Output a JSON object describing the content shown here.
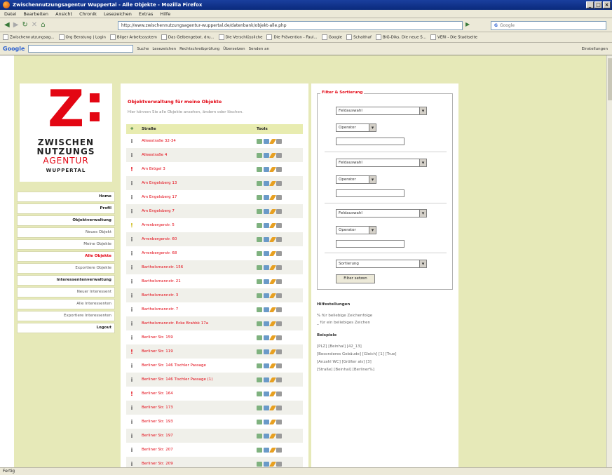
{
  "window": {
    "title": "Zwischennutzungsagentur Wuppertal - Alle Objekte - Mozilla Firefox"
  },
  "menu": [
    "Datei",
    "Bearbeiten",
    "Ansicht",
    "Chronik",
    "Lesezeichen",
    "Extras",
    "Hilfe"
  ],
  "address": {
    "url": "http://www.zwischennutzungsagentur-wuppertal.de/datenbank/objekt-alle.php",
    "search_placeholder": "Google"
  },
  "bookmarks": [
    "Zwischennutzungsag...",
    "Org Beratung | Login",
    "Bilger Arbeitssystem",
    "Das Gelbengebot. dru...",
    "Die Verschlüssliche",
    "Die Prävention - Faul...",
    "Google",
    "Schalthaf",
    "BIG-Diks. Die neue S...",
    "VERI - Die Stadtseite"
  ],
  "googlebar": {
    "logo": "Google",
    "items": [
      "Suche",
      "Lesezeichen",
      "Rechtschreibprüfung",
      "Übersetzen",
      "Senden an"
    ],
    "settings": "Einstellungen"
  },
  "logo": {
    "mark": "Z",
    "line1": "ZWISCHEN",
    "line2": "NUTZUNGS",
    "line3": "AGENTUR",
    "line4": "WUPPERTAL"
  },
  "nav": [
    {
      "label": "Home",
      "style": "bold"
    },
    {
      "label": "Profil",
      "style": "bold"
    },
    {
      "label": "Objektverwaltung",
      "style": "bold"
    },
    {
      "label": "Neues Objekt",
      "style": "normal"
    },
    {
      "label": "Meine Objekte",
      "style": "normal"
    },
    {
      "label": "Alle Objekte",
      "style": "active"
    },
    {
      "label": "Exportiere Objekte",
      "style": "normal"
    },
    {
      "label": "Interessentenverwaltung",
      "style": "bold"
    },
    {
      "label": "Neuer Interessent",
      "style": "normal"
    },
    {
      "label": "Alle Interessenten",
      "style": "normal"
    },
    {
      "label": "Exportiere Interessenten",
      "style": "normal"
    },
    {
      "label": "Logout",
      "style": "bold"
    }
  ],
  "main": {
    "title": "Objektverwaltung für meine Objekte",
    "description": "Hier können Sie alle Objekte ansehen, ändern oder löschen.",
    "col_street": "Straße",
    "col_tools": "Tools",
    "rows": [
      {
        "status": "i",
        "status_color": "grey",
        "street": "Alleestraße 32-34"
      },
      {
        "status": "i",
        "status_color": "grey",
        "street": "Alleestraße 4"
      },
      {
        "status": "!",
        "status_color": "red",
        "street": "Am Brögel 3"
      },
      {
        "status": "i",
        "status_color": "grey",
        "street": "Am Engelsberg 13"
      },
      {
        "status": "i",
        "status_color": "grey",
        "street": "Am Engelsberg 17"
      },
      {
        "status": "i",
        "status_color": "grey",
        "street": "Am Engelsberg 7"
      },
      {
        "status": "!",
        "status_color": "yellow",
        "street": "Arrenbergerstr. 5"
      },
      {
        "status": "i",
        "status_color": "grey",
        "street": "Arrenbergerstr. 60"
      },
      {
        "status": "i",
        "status_color": "grey",
        "street": "Arrenbergerstr. 68"
      },
      {
        "status": "i",
        "status_color": "grey",
        "street": "Barthelsmannstr. 156"
      },
      {
        "status": "i",
        "status_color": "grey",
        "street": "Barthelsmannstr. 21"
      },
      {
        "status": "i",
        "status_color": "grey",
        "street": "Barthelsmannstr. 3"
      },
      {
        "status": "i",
        "status_color": "grey",
        "street": "Barthelsmannstr. 7"
      },
      {
        "status": "i",
        "status_color": "grey",
        "street": "Barthelsmannstr. Ecke Brahbk 17a"
      },
      {
        "status": "i",
        "status_color": "grey",
        "street": "Berliner Str. 159"
      },
      {
        "status": "!",
        "status_color": "red",
        "street": "Berliner Str. 119"
      },
      {
        "status": "i",
        "status_color": "grey",
        "street": "Berliner Str. 146 Tischler Passage"
      },
      {
        "status": "i",
        "status_color": "grey",
        "street": "Berliner Str. 146 Tischler Passage (1)"
      },
      {
        "status": "!",
        "status_color": "red",
        "street": "Berliner Str. 164"
      },
      {
        "status": "i",
        "status_color": "grey",
        "street": "Berliner Str. 173"
      },
      {
        "status": "i",
        "status_color": "grey",
        "street": "Berliner Str. 193"
      },
      {
        "status": "i",
        "status_color": "grey",
        "street": "Berliner Str. 197"
      },
      {
        "status": "i",
        "status_color": "grey",
        "street": "Berliner Str. 207"
      },
      {
        "status": "i",
        "status_color": "grey",
        "street": "Berliner Str. 209"
      }
    ]
  },
  "filter": {
    "legend": "Filter & Sortierung",
    "field_select": "Feldauswahl",
    "operator_select": "Operator",
    "sort_select": "Sortierung",
    "button": "Filter setzen",
    "help_title_wildcards": "Hilfestellungen",
    "help_wildcard_1": "% für beliebige Zeichenfolge",
    "help_wildcard_2": "_ für ein beliebiges Zeichen",
    "help_title_examples": "Beispiele",
    "examples": [
      "[PLZ] [Beinhal] [42_13]",
      "[Besonderes Gebäude] [Gleich] [1] [True]",
      "[Anzahl WC] [Größer als] [3]",
      "[Straße] [Beinhal] [Berliner%]"
    ]
  },
  "status": "Fertig"
}
